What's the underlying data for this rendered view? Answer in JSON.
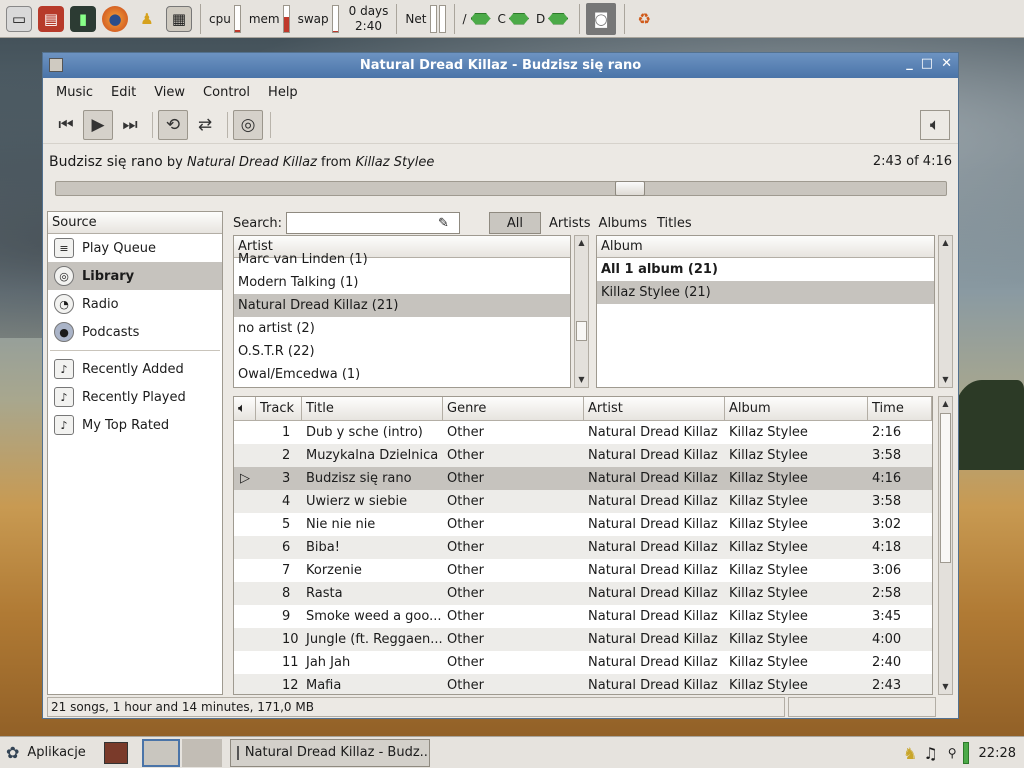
{
  "top_panel": {
    "launchers": [
      "drive-icon",
      "monitor-icon",
      "terminal-icon",
      "firefox-icon",
      "pidgin-icon",
      "calculator-icon"
    ],
    "monitors": [
      {
        "label": "cpu",
        "level": 0.05
      },
      {
        "label": "mem",
        "level": 0.55
      },
      {
        "label": "swap",
        "level": 0.03
      }
    ],
    "uptime_line1": "0 days",
    "uptime_line2": "2:40",
    "net_label": "Net",
    "drives": [
      {
        "label": "/"
      },
      {
        "label": "C"
      },
      {
        "label": "D"
      }
    ]
  },
  "window": {
    "title": "Natural Dread Killaz - Budzisz się rano",
    "menu": [
      "Music",
      "Edit",
      "View",
      "Control",
      "Help"
    ]
  },
  "now_playing": {
    "title": "Budzisz się rano",
    "by": "by",
    "artist": "Natural Dread Killaz",
    "from": "from",
    "album": "Killaz Stylee",
    "time": "2:43 of 4:16",
    "progress": 0.65
  },
  "source": {
    "header": "Source",
    "items": [
      {
        "label": "Play Queue",
        "icon": "playlist-icon"
      },
      {
        "label": "Library",
        "icon": "library-icon"
      },
      {
        "label": "Radio",
        "icon": "radio-icon"
      },
      {
        "label": "Podcasts",
        "icon": "podcast-icon"
      }
    ],
    "playlists": [
      {
        "label": "Recently Added",
        "icon": "smart-playlist-icon"
      },
      {
        "label": "Recently Played",
        "icon": "smart-playlist-icon"
      },
      {
        "label": "My Top Rated",
        "icon": "smart-playlist-icon"
      }
    ]
  },
  "search": {
    "label": "Search:",
    "value": "",
    "filters": [
      "All",
      "Artists",
      "Albums",
      "Titles"
    ]
  },
  "artist_pane": {
    "header": "Artist",
    "rows": [
      "Marc van Linden (1)",
      "Modern Talking (1)",
      "Natural Dread Killaz (21)",
      "no artist (2)",
      "O.S.T.R (22)",
      "Owal/Emcedwa (1)"
    ]
  },
  "album_pane": {
    "header": "Album",
    "rows": [
      "All 1 album (21)",
      "Killaz Stylee (21)"
    ]
  },
  "tracks": {
    "headers": [
      "Track",
      "Title",
      "Genre",
      "Artist",
      "Album",
      "Time"
    ],
    "rows": [
      [
        "1",
        "Dub y sche (intro)",
        "Other",
        "Natural Dread Killaz",
        "Killaz Stylee",
        "2:16"
      ],
      [
        "2",
        "Muzykalna Dzielnica",
        "Other",
        "Natural Dread Killaz",
        "Killaz Stylee",
        "3:58"
      ],
      [
        "3",
        "Budzisz się rano",
        "Other",
        "Natural Dread Killaz",
        "Killaz Stylee",
        "4:16"
      ],
      [
        "4",
        "Uwierz w siebie",
        "Other",
        "Natural Dread Killaz",
        "Killaz Stylee",
        "3:58"
      ],
      [
        "5",
        "Nie nie nie",
        "Other",
        "Natural Dread Killaz",
        "Killaz Stylee",
        "3:02"
      ],
      [
        "6",
        "Biba!",
        "Other",
        "Natural Dread Killaz",
        "Killaz Stylee",
        "4:18"
      ],
      [
        "7",
        "Korzenie",
        "Other",
        "Natural Dread Killaz",
        "Killaz Stylee",
        "3:06"
      ],
      [
        "8",
        "Rasta",
        "Other",
        "Natural Dread Killaz",
        "Killaz Stylee",
        "2:58"
      ],
      [
        "9",
        "Smoke weed a goo...",
        "Other",
        "Natural Dread Killaz",
        "Killaz Stylee",
        "3:45"
      ],
      [
        "10",
        "Jungle (ft. Reggaen...",
        "Other",
        "Natural Dread Killaz",
        "Killaz Stylee",
        "4:00"
      ],
      [
        "11",
        "Jah Jah",
        "Other",
        "Natural Dread Killaz",
        "Killaz Stylee",
        "2:40"
      ],
      [
        "12",
        "Mafia",
        "Other",
        "Natural Dread Killaz",
        "Killaz Stylee",
        "2:43"
      ]
    ],
    "playing_index": 2
  },
  "status": "21 songs, 1 hour and 14 minutes, 171,0 MB",
  "bottom_panel": {
    "menu_label": "Aplikacje",
    "task_label": "Natural Dread Killaz - Budz...",
    "clock": "22:28"
  }
}
